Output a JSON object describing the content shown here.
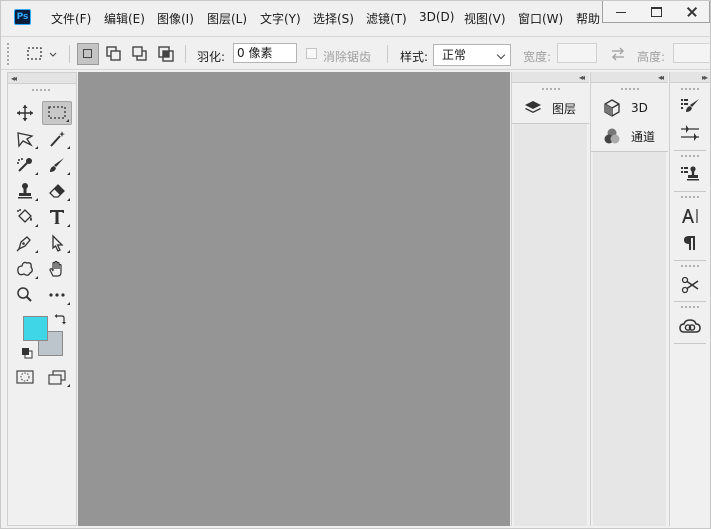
{
  "app": {
    "logo_text": "Ps"
  },
  "menu": [
    {
      "label": "文件(F)"
    },
    {
      "label": "编辑(E)"
    },
    {
      "label": "图像(I)"
    },
    {
      "label": "图层(L)"
    },
    {
      "label": "文字(Y)"
    },
    {
      "label": "选择(S)"
    },
    {
      "label": "滤镜(T)"
    },
    {
      "label": "3D(D)"
    },
    {
      "label": "视图(V)"
    },
    {
      "label": "窗口(W)"
    },
    {
      "label": "帮助"
    }
  ],
  "window_controls": {
    "minimize": "minimize-icon",
    "maximize": "maximize-icon",
    "close": "close-icon"
  },
  "options": {
    "feather_label": "羽化:",
    "feather_value": "0 像素",
    "antialias_label": "消除锯齿",
    "style_label": "样式:",
    "style_value": "正常",
    "width_label": "宽度:",
    "height_label": "高度:",
    "width_value": "",
    "height_value": ""
  },
  "panels": {
    "layers": {
      "label": "图层",
      "icon": "layers-icon"
    },
    "three_d": {
      "label": "3D",
      "icon": "cube-icon"
    },
    "channels": {
      "label": "通道",
      "icon": "channels-icon"
    }
  },
  "colors": {
    "foreground": "#3fd6e8",
    "background": "#bcc4cc",
    "canvas": "#959595",
    "ps_blue": "#31a8ff"
  }
}
